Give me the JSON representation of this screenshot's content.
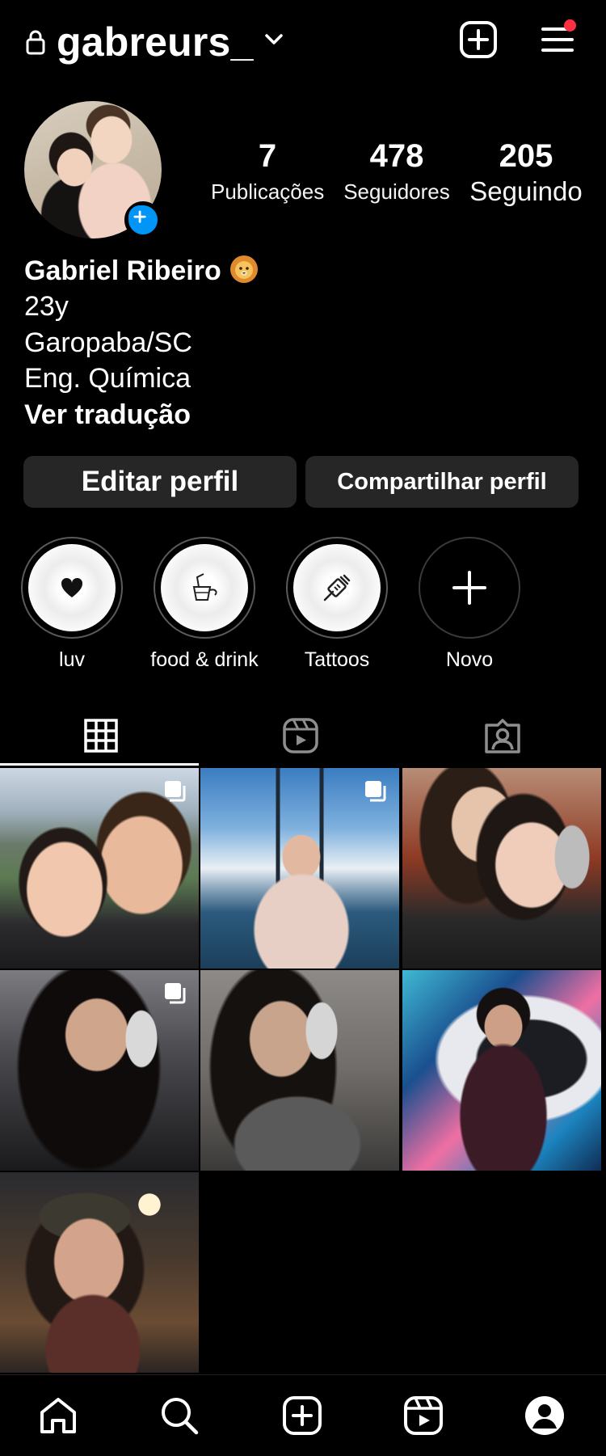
{
  "header": {
    "username": "gabreurs_",
    "icons": {
      "lock": "lock-icon",
      "chevron": "chevron-down-icon",
      "add": "add-content-icon",
      "menu": "menu-icon"
    },
    "notification_color": "#ff3040"
  },
  "profile": {
    "stats": [
      {
        "value": "7",
        "label": "Publicações"
      },
      {
        "value": "478",
        "label": "Seguidores"
      },
      {
        "value": "205",
        "label": "Seguindo"
      }
    ],
    "name": "Gabriel Ribeiro",
    "name_emoji": "lion-emoji",
    "bio": [
      "23y",
      "Garopaba/SC",
      "Eng. Química"
    ],
    "translate_label": "Ver tradução",
    "add_story_color": "#0095f6"
  },
  "actions": {
    "edit_label": "Editar perfil",
    "share_label": "Compartilhar perfil"
  },
  "highlights": [
    {
      "label": "luv",
      "icon": "heart-icon"
    },
    {
      "label": "food & drink",
      "icon": "drink-icon"
    },
    {
      "label": "Tattoos",
      "icon": "tattoo-machine-icon"
    },
    {
      "label": "Novo",
      "icon": "plus-icon"
    }
  ],
  "tabs": [
    {
      "name": "posts-grid",
      "icon": "grid-icon",
      "active": true
    },
    {
      "name": "reels",
      "icon": "reels-icon",
      "active": false
    },
    {
      "name": "tagged",
      "icon": "tagged-icon",
      "active": false
    }
  ],
  "posts": [
    {
      "multi": true
    },
    {
      "multi": true
    },
    {
      "multi": false
    },
    {
      "multi": true
    },
    {
      "multi": false
    },
    {
      "multi": false
    },
    {
      "multi": false
    }
  ],
  "bottom_nav": [
    {
      "icon": "home-icon"
    },
    {
      "icon": "search-icon"
    },
    {
      "icon": "create-icon"
    },
    {
      "icon": "reels-icon"
    },
    {
      "icon": "profile-icon"
    }
  ]
}
